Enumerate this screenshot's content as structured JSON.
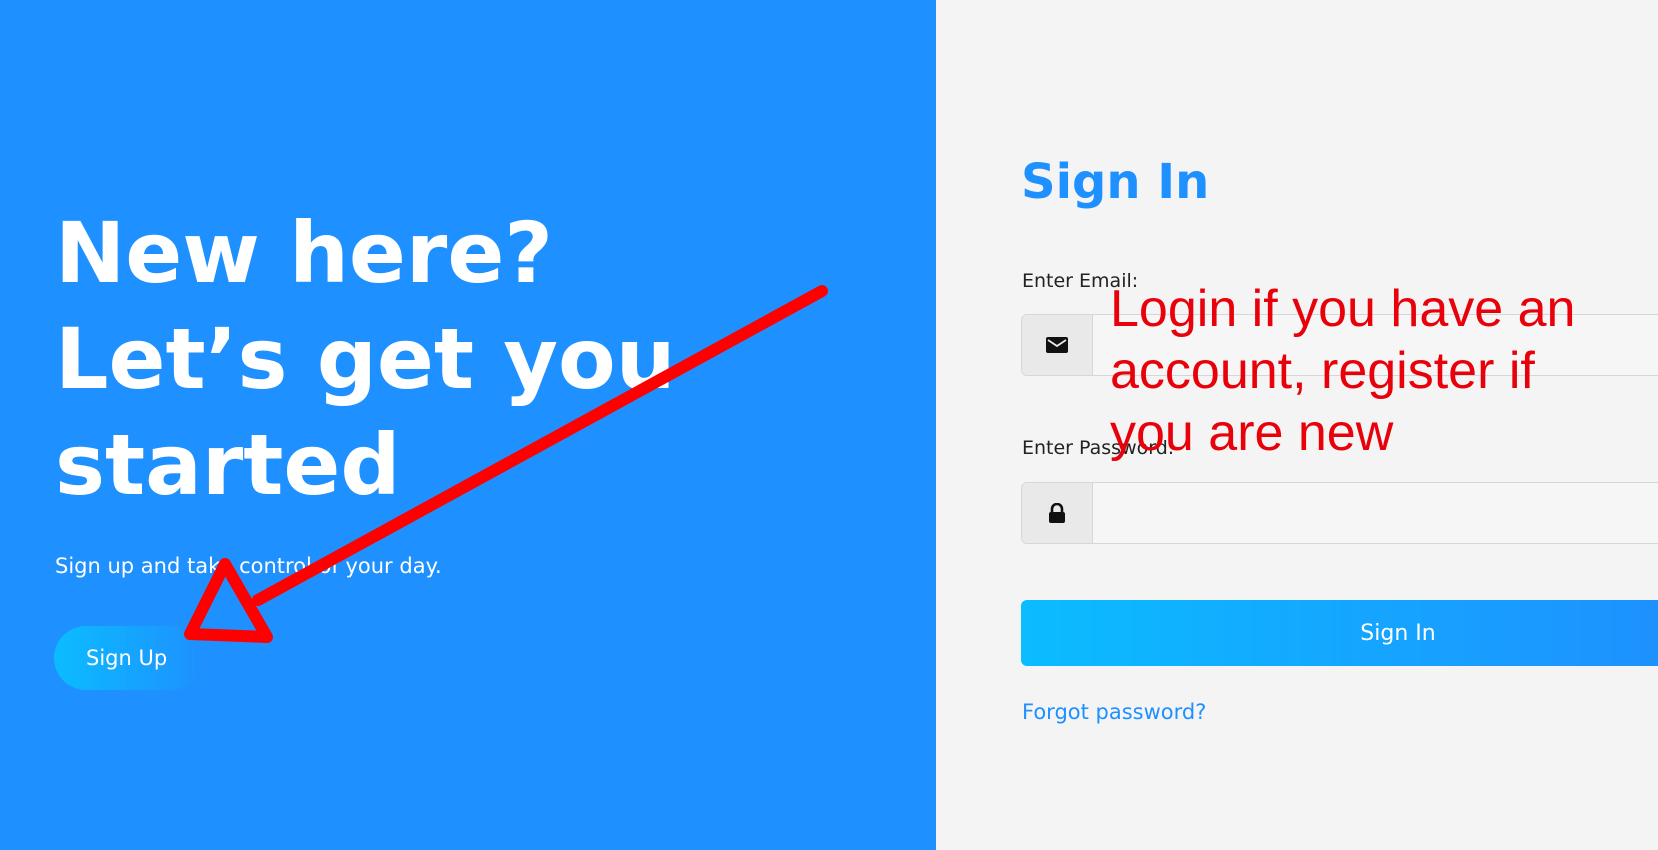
{
  "left_panel": {
    "background_color": "#1e90ff",
    "headline_lines": [
      "New here?",
      "Let’s get you",
      "started"
    ],
    "subtext": "Sign up and take control of your day.",
    "signup_button_label": "Sign Up"
  },
  "form": {
    "title": "Sign In",
    "email_label": "Enter Email:",
    "email_value": "",
    "email_icon": "envelope-icon",
    "password_label": "Enter Password:",
    "password_value": "",
    "password_icon": "lock-icon",
    "signin_button_label": "Sign In",
    "forgot_password_label": "Forgot password?",
    "accent_color": "#1e90ff"
  },
  "annotation": {
    "text_lines": [
      "Login if you have an",
      "account, register if",
      "you are new"
    ],
    "color": "#e8000b",
    "arrow_icon": "red-arrow-pointing-to-signup"
  }
}
